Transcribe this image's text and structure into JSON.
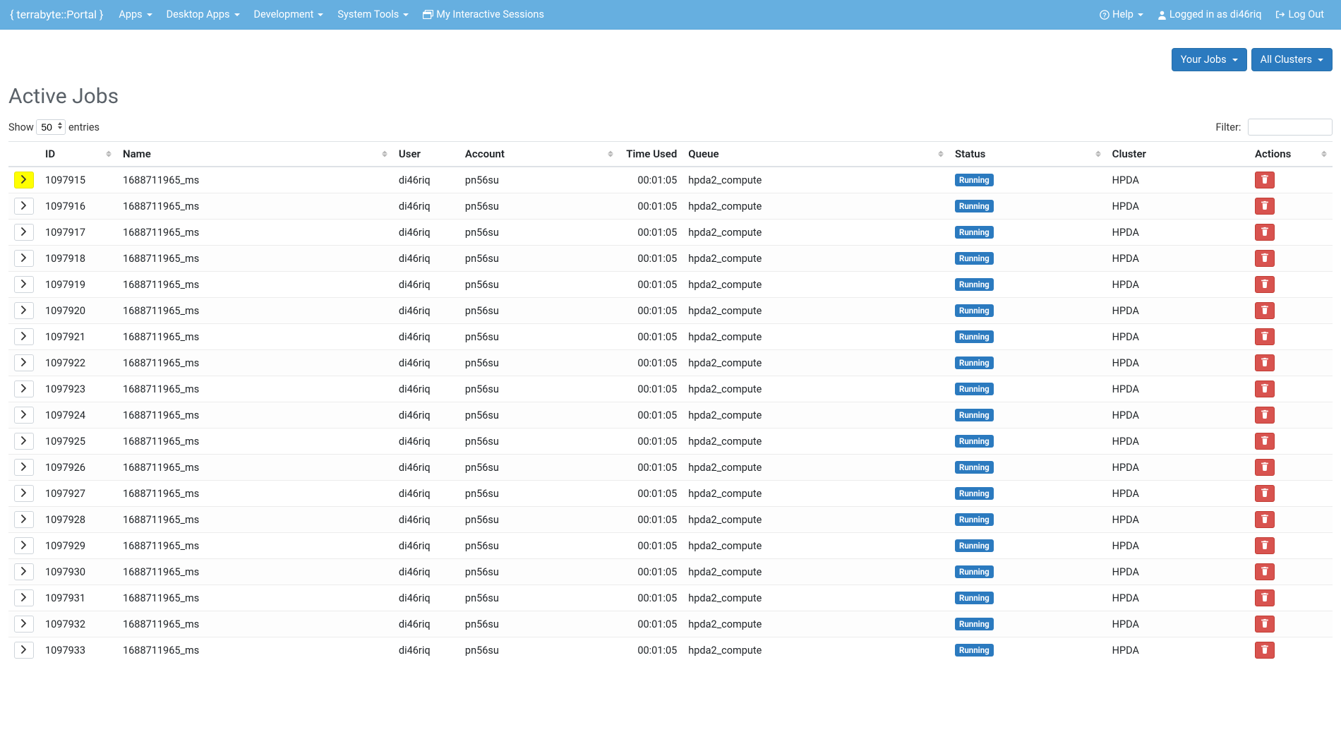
{
  "brand": "{ terrabyte::Portal }",
  "nav": {
    "left": [
      {
        "label": "Apps",
        "dropdown": true
      },
      {
        "label": "Desktop Apps",
        "dropdown": true
      },
      {
        "label": "Development",
        "dropdown": true
      },
      {
        "label": "System Tools",
        "dropdown": true
      },
      {
        "label": "My Interactive Sessions",
        "dropdown": false,
        "icon": "window-restore"
      }
    ],
    "right": {
      "help": "Help",
      "logged_in": "Logged in as di46riq",
      "logout": "Log Out"
    }
  },
  "top_buttons": {
    "your_jobs": "Your Jobs",
    "all_clusters": "All Clusters"
  },
  "page_title": "Active Jobs",
  "table_controls": {
    "show_prefix": "Show",
    "show_suffix": "entries",
    "page_size": "50",
    "filter_label": "Filter:"
  },
  "columns": [
    "ID",
    "Name",
    "User",
    "Account",
    "Time Used",
    "Queue",
    "Status",
    "Cluster",
    "Actions"
  ],
  "status_label": "Running",
  "rows": [
    {
      "id": "1097915",
      "name": "1688711965_ms",
      "user": "di46riq",
      "account": "pn56su",
      "time": "00:01:05",
      "queue": "hpda2_compute",
      "cluster": "HPDA",
      "highlight": true
    },
    {
      "id": "1097916",
      "name": "1688711965_ms",
      "user": "di46riq",
      "account": "pn56su",
      "time": "00:01:05",
      "queue": "hpda2_compute",
      "cluster": "HPDA"
    },
    {
      "id": "1097917",
      "name": "1688711965_ms",
      "user": "di46riq",
      "account": "pn56su",
      "time": "00:01:05",
      "queue": "hpda2_compute",
      "cluster": "HPDA"
    },
    {
      "id": "1097918",
      "name": "1688711965_ms",
      "user": "di46riq",
      "account": "pn56su",
      "time": "00:01:05",
      "queue": "hpda2_compute",
      "cluster": "HPDA"
    },
    {
      "id": "1097919",
      "name": "1688711965_ms",
      "user": "di46riq",
      "account": "pn56su",
      "time": "00:01:05",
      "queue": "hpda2_compute",
      "cluster": "HPDA"
    },
    {
      "id": "1097920",
      "name": "1688711965_ms",
      "user": "di46riq",
      "account": "pn56su",
      "time": "00:01:05",
      "queue": "hpda2_compute",
      "cluster": "HPDA"
    },
    {
      "id": "1097921",
      "name": "1688711965_ms",
      "user": "di46riq",
      "account": "pn56su",
      "time": "00:01:05",
      "queue": "hpda2_compute",
      "cluster": "HPDA"
    },
    {
      "id": "1097922",
      "name": "1688711965_ms",
      "user": "di46riq",
      "account": "pn56su",
      "time": "00:01:05",
      "queue": "hpda2_compute",
      "cluster": "HPDA"
    },
    {
      "id": "1097923",
      "name": "1688711965_ms",
      "user": "di46riq",
      "account": "pn56su",
      "time": "00:01:05",
      "queue": "hpda2_compute",
      "cluster": "HPDA"
    },
    {
      "id": "1097924",
      "name": "1688711965_ms",
      "user": "di46riq",
      "account": "pn56su",
      "time": "00:01:05",
      "queue": "hpda2_compute",
      "cluster": "HPDA"
    },
    {
      "id": "1097925",
      "name": "1688711965_ms",
      "user": "di46riq",
      "account": "pn56su",
      "time": "00:01:05",
      "queue": "hpda2_compute",
      "cluster": "HPDA"
    },
    {
      "id": "1097926",
      "name": "1688711965_ms",
      "user": "di46riq",
      "account": "pn56su",
      "time": "00:01:05",
      "queue": "hpda2_compute",
      "cluster": "HPDA"
    },
    {
      "id": "1097927",
      "name": "1688711965_ms",
      "user": "di46riq",
      "account": "pn56su",
      "time": "00:01:05",
      "queue": "hpda2_compute",
      "cluster": "HPDA"
    },
    {
      "id": "1097928",
      "name": "1688711965_ms",
      "user": "di46riq",
      "account": "pn56su",
      "time": "00:01:05",
      "queue": "hpda2_compute",
      "cluster": "HPDA"
    },
    {
      "id": "1097929",
      "name": "1688711965_ms",
      "user": "di46riq",
      "account": "pn56su",
      "time": "00:01:05",
      "queue": "hpda2_compute",
      "cluster": "HPDA"
    },
    {
      "id": "1097930",
      "name": "1688711965_ms",
      "user": "di46riq",
      "account": "pn56su",
      "time": "00:01:05",
      "queue": "hpda2_compute",
      "cluster": "HPDA"
    },
    {
      "id": "1097931",
      "name": "1688711965_ms",
      "user": "di46riq",
      "account": "pn56su",
      "time": "00:01:05",
      "queue": "hpda2_compute",
      "cluster": "HPDA"
    },
    {
      "id": "1097932",
      "name": "1688711965_ms",
      "user": "di46riq",
      "account": "pn56su",
      "time": "00:01:05",
      "queue": "hpda2_compute",
      "cluster": "HPDA"
    },
    {
      "id": "1097933",
      "name": "1688711965_ms",
      "user": "di46riq",
      "account": "pn56su",
      "time": "00:01:05",
      "queue": "hpda2_compute",
      "cluster": "HPDA"
    }
  ]
}
